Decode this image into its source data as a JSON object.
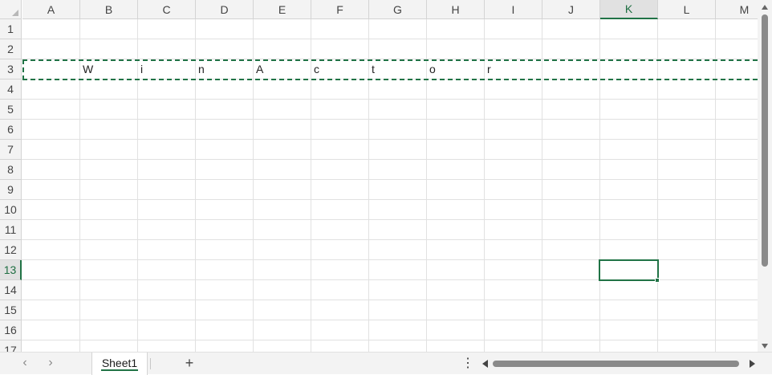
{
  "columns": [
    "A",
    "B",
    "C",
    "D",
    "E",
    "F",
    "G",
    "H",
    "I",
    "J",
    "K",
    "L",
    "M"
  ],
  "rows": [
    "1",
    "2",
    "3",
    "4",
    "5",
    "6",
    "7",
    "8",
    "9",
    "10",
    "11",
    "12",
    "13",
    "14",
    "15",
    "16",
    "17"
  ],
  "active_column": "K",
  "active_row": "13",
  "cells": [
    {
      "ref": "B3",
      "value": "W"
    },
    {
      "ref": "C3",
      "value": "i"
    },
    {
      "ref": "D3",
      "value": "n"
    },
    {
      "ref": "E3",
      "value": "A"
    },
    {
      "ref": "F3",
      "value": "c"
    },
    {
      "ref": "G3",
      "value": "t"
    },
    {
      "ref": "H3",
      "value": "o"
    },
    {
      "ref": "I3",
      "value": "r"
    }
  ],
  "tabs": {
    "sheet1_label": "Sheet1",
    "add_label": "+",
    "prev_label": "‹",
    "next_label": "›",
    "more_label": "⋮"
  },
  "colors": {
    "accent": "#217346"
  }
}
